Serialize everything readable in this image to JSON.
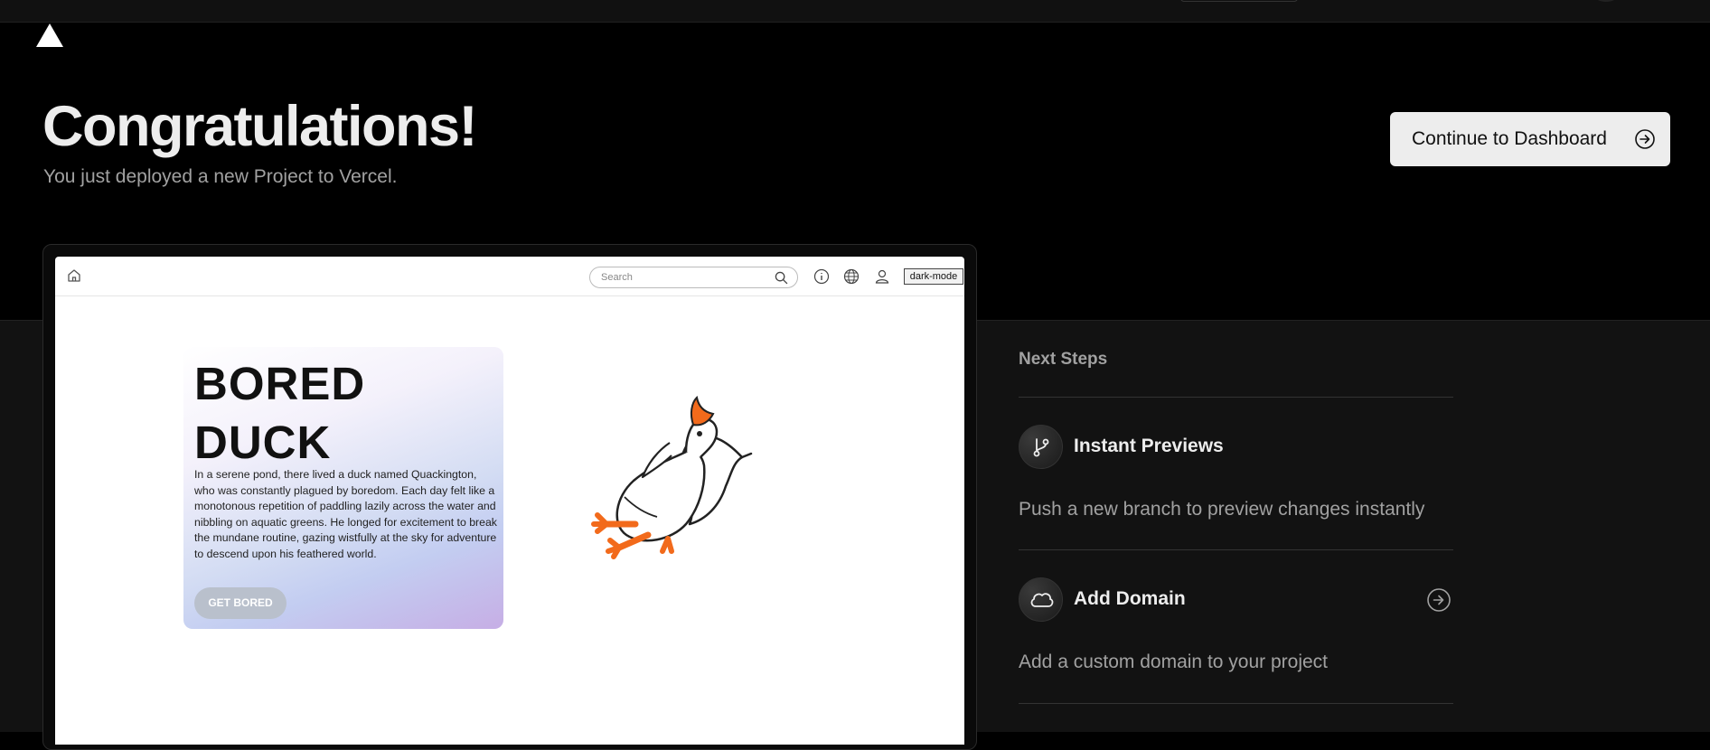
{
  "header": {
    "title": "Congratulations!",
    "subtitle": "You just deployed a new Project to Vercel.",
    "cta_label": "Continue to Dashboard"
  },
  "preview": {
    "search_placeholder": "Search",
    "theme_button": "dark-mode",
    "card_title_line1": "BORED",
    "card_title_line2": "DUCK",
    "card_body": "In a serene pond, there lived a duck named Quackington, who was constantly plagued by boredom. Each day felt like a monotonous repetition of paddling lazily across the water and nibbling on aquatic greens. He longed for excitement to break the mundane routine, gazing wistfully at the sky for adventure to descend upon his feathered world.",
    "card_button": "GET BORED"
  },
  "next_steps": {
    "heading": "Next Steps",
    "items": [
      {
        "title": "Instant Previews",
        "description": "Push a new branch to preview changes instantly",
        "icon": "git-branch-icon"
      },
      {
        "title": "Add Domain",
        "description": "Add a custom domain to your project",
        "icon": "cloud-icon"
      }
    ]
  },
  "colors": {
    "background": "#000000",
    "panel": "#121212",
    "cta_background": "#ededed",
    "duck_orange": "#f26a1b"
  }
}
